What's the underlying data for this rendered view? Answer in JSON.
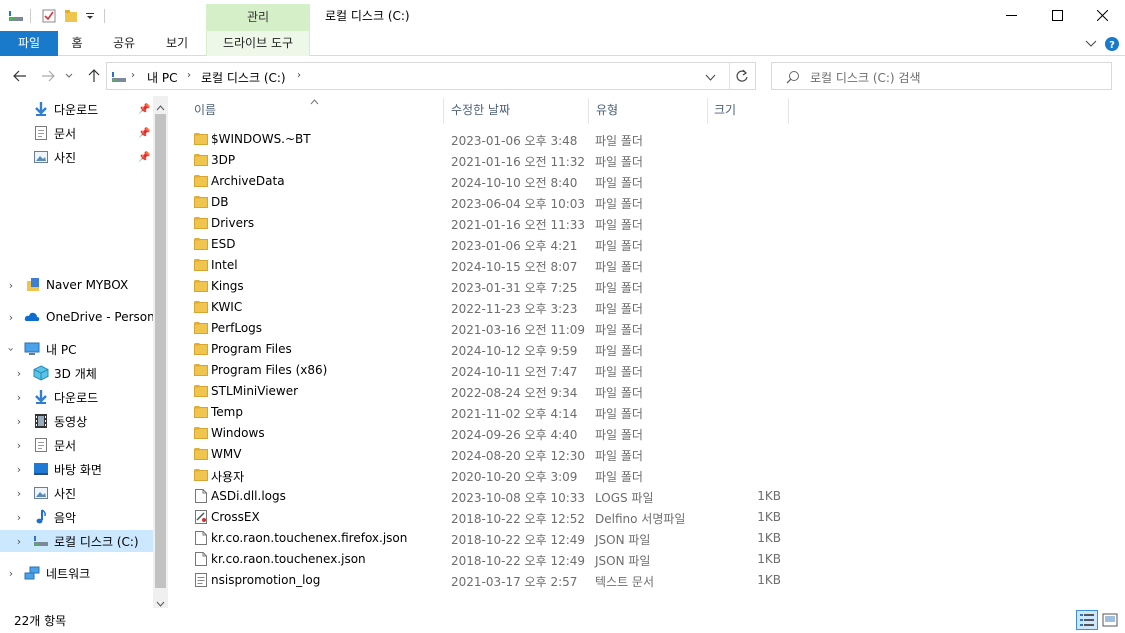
{
  "window": {
    "title": "로컬 디스크 (C:)",
    "context_tab": "관리"
  },
  "ribbon": {
    "tabs": [
      "파일",
      "홈",
      "공유",
      "보기",
      "드라이브 도구"
    ]
  },
  "address": {
    "crumbs": [
      "내 PC",
      "로컬 디스크 (C:)"
    ]
  },
  "search": {
    "placeholder": "로컬 디스크 (C:) 검색"
  },
  "nav": {
    "quick": [
      {
        "label": "다운로드",
        "icon": "download-arrow-icon"
      },
      {
        "label": "문서",
        "icon": "document-icon"
      },
      {
        "label": "사진",
        "icon": "picture-icon"
      }
    ],
    "roots": [
      {
        "label": "Naver MYBOX",
        "icon": "mybox-icon"
      },
      {
        "label": "OneDrive - Persona",
        "icon": "onedrive-cloud-icon"
      },
      {
        "label": "내 PC",
        "icon": "pc-monitor-icon"
      }
    ],
    "pc_children": [
      {
        "label": "3D 개체",
        "icon": "cube-3d-icon"
      },
      {
        "label": "다운로드",
        "icon": "download-arrow-icon"
      },
      {
        "label": "동영상",
        "icon": "film-icon"
      },
      {
        "label": "문서",
        "icon": "document-icon"
      },
      {
        "label": "바탕 화면",
        "icon": "desktop-icon"
      },
      {
        "label": "사진",
        "icon": "picture-icon"
      },
      {
        "label": "음악",
        "icon": "music-note-icon"
      },
      {
        "label": "로컬 디스크 (C:)",
        "icon": "drive-icon"
      }
    ],
    "network": {
      "label": "네트워크",
      "icon": "network-icon"
    }
  },
  "columns": {
    "name": "이름",
    "date": "수정한 날짜",
    "type": "유형",
    "size": "크기"
  },
  "files": [
    {
      "name": "$WINDOWS.~BT",
      "date": "2023-01-06 오후 3:48",
      "type": "파일 폴더",
      "size": "",
      "kind": "folder"
    },
    {
      "name": "3DP",
      "date": "2021-01-16 오전 11:32",
      "type": "파일 폴더",
      "size": "",
      "kind": "folder"
    },
    {
      "name": "ArchiveData",
      "date": "2024-10-10 오전 8:40",
      "type": "파일 폴더",
      "size": "",
      "kind": "folder"
    },
    {
      "name": "DB",
      "date": "2023-06-04 오후 10:03",
      "type": "파일 폴더",
      "size": "",
      "kind": "folder"
    },
    {
      "name": "Drivers",
      "date": "2021-01-16 오전 11:33",
      "type": "파일 폴더",
      "size": "",
      "kind": "folder"
    },
    {
      "name": "ESD",
      "date": "2023-01-06 오후 4:21",
      "type": "파일 폴더",
      "size": "",
      "kind": "folder"
    },
    {
      "name": "Intel",
      "date": "2024-10-15 오전 8:07",
      "type": "파일 폴더",
      "size": "",
      "kind": "folder"
    },
    {
      "name": "Kings",
      "date": "2023-01-31 오후 7:25",
      "type": "파일 폴더",
      "size": "",
      "kind": "folder"
    },
    {
      "name": "KWIC",
      "date": "2022-11-23 오후 3:23",
      "type": "파일 폴더",
      "size": "",
      "kind": "folder"
    },
    {
      "name": "PerfLogs",
      "date": "2021-03-16 오전 11:09",
      "type": "파일 폴더",
      "size": "",
      "kind": "folder"
    },
    {
      "name": "Program Files",
      "date": "2024-10-12 오후 9:59",
      "type": "파일 폴더",
      "size": "",
      "kind": "folder"
    },
    {
      "name": "Program Files (x86)",
      "date": "2024-10-11 오전 7:47",
      "type": "파일 폴더",
      "size": "",
      "kind": "folder"
    },
    {
      "name": "STLMiniViewer",
      "date": "2022-08-24 오전 9:34",
      "type": "파일 폴더",
      "size": "",
      "kind": "folder"
    },
    {
      "name": "Temp",
      "date": "2021-11-02 오후 4:14",
      "type": "파일 폴더",
      "size": "",
      "kind": "folder"
    },
    {
      "name": "Windows",
      "date": "2024-09-26 오후 4:40",
      "type": "파일 폴더",
      "size": "",
      "kind": "folder"
    },
    {
      "name": "WMV",
      "date": "2024-08-20 오후 12:30",
      "type": "파일 폴더",
      "size": "",
      "kind": "folder"
    },
    {
      "name": "사용자",
      "date": "2020-10-20 오후 3:09",
      "type": "파일 폴더",
      "size": "",
      "kind": "folder"
    },
    {
      "name": "ASDi.dll.logs",
      "date": "2023-10-08 오후 10:33",
      "type": "LOGS 파일",
      "size": "1KB",
      "kind": "file"
    },
    {
      "name": "CrossEX",
      "date": "2018-10-22 오후 12:52",
      "type": "Delfino 서명파일",
      "size": "1KB",
      "kind": "signed"
    },
    {
      "name": "kr.co.raon.touchenex.firefox.json",
      "date": "2018-10-22 오후 12:49",
      "type": "JSON 파일",
      "size": "1KB",
      "kind": "file"
    },
    {
      "name": "kr.co.raon.touchenex.json",
      "date": "2018-10-22 오후 12:49",
      "type": "JSON 파일",
      "size": "1KB",
      "kind": "file"
    },
    {
      "name": "nsispromotion_log",
      "date": "2021-03-17 오후 2:57",
      "type": "텍스트 문서",
      "size": "1KB",
      "kind": "text"
    }
  ],
  "status": {
    "item_count": "22개 항목"
  },
  "colors": {
    "accent": "#1979ca",
    "context_tab": "#d5f0c8",
    "selection": "#cce8ff",
    "folder": "#f0c54e"
  }
}
